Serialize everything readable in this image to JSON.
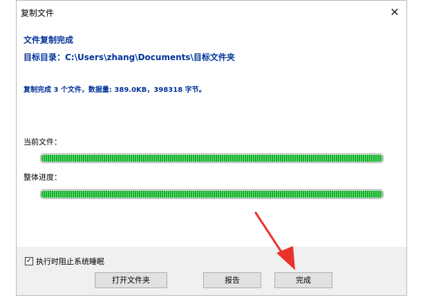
{
  "window": {
    "title": "复制文件",
    "close_glyph": "✕"
  },
  "content": {
    "heading": "文件复制完成",
    "target_line": "目标目录：C:\\Users\\zhang\\Documents\\目标文件夹",
    "summary": "复制完成 3 个文件，数据量: 389.0KB，398318 字节。",
    "current_file_label": "当前文件：",
    "overall_label": "整体进度：",
    "current_progress": 1.0,
    "overall_progress": 1.0
  },
  "footer": {
    "prevent_sleep_label": "执行时阻止系统睡眠",
    "prevent_sleep_checked": true,
    "check_glyph": "✓",
    "open_folder_label": "打开文件夹",
    "report_label": "报告",
    "done_label": "完成"
  },
  "colors": {
    "accent_text": "#003399",
    "progress_green": "#06b025",
    "annotation_arrow": "#e8322b"
  },
  "annotation": {
    "arrow": "red-arrow-pointing-to-done-button"
  }
}
